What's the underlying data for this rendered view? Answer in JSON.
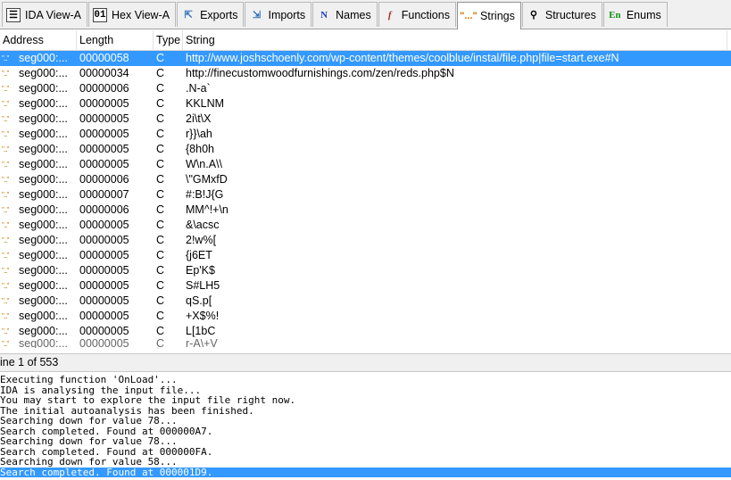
{
  "tabs": [
    {
      "label": "IDA View-A",
      "icon": "ida-view-icon",
      "active": false
    },
    {
      "label": "Hex View-A",
      "icon": "hex-view-icon",
      "active": false
    },
    {
      "label": "Exports",
      "icon": "exports-icon",
      "active": false
    },
    {
      "label": "Imports",
      "icon": "imports-icon",
      "active": false
    },
    {
      "label": "Names",
      "icon": "names-icon",
      "active": false
    },
    {
      "label": "Functions",
      "icon": "functions-icon",
      "active": false
    },
    {
      "label": "Strings",
      "icon": "strings-icon",
      "active": true
    },
    {
      "label": "Structures",
      "icon": "structures-icon",
      "active": false
    },
    {
      "label": "Enums",
      "icon": "enums-icon",
      "active": false
    }
  ],
  "tab_icons": {
    "ida": "☰",
    "hex": "01",
    "exports": "⇱",
    "imports": "⇲",
    "names": "N",
    "functions": "f",
    "strings": "\"...\"",
    "structures": "⚲",
    "enums": "En"
  },
  "columns": [
    "Address",
    "Length",
    "Type",
    "String"
  ],
  "row_icon": "\"...\"",
  "rows": [
    {
      "address": "seg000:...",
      "length": "00000058",
      "type": "C",
      "string": "http://www.joshschoenly.com/wp-content/themes/coolblue/instal/file.php|file=start.exe#N",
      "selected": true
    },
    {
      "address": "seg000:...",
      "length": "00000034",
      "type": "C",
      "string": "http://finecustomwoodfurnishings.com/zen/reds.php$N"
    },
    {
      "address": "seg000:...",
      "length": "00000006",
      "type": "C",
      "string": ".N-a`"
    },
    {
      "address": "seg000:...",
      "length": "00000005",
      "type": "C",
      "string": "KKLNM"
    },
    {
      "address": "seg000:...",
      "length": "00000005",
      "type": "C",
      "string": "2i\\t\\X"
    },
    {
      "address": "seg000:...",
      "length": "00000005",
      "type": "C",
      "string": "r}}\\ah"
    },
    {
      "address": "seg000:...",
      "length": "00000005",
      "type": "C",
      "string": "{8h0h"
    },
    {
      "address": "seg000:...",
      "length": "00000005",
      "type": "C",
      "string": "W\\n.A\\\\"
    },
    {
      "address": "seg000:...",
      "length": "00000006",
      "type": "C",
      "string": "\\\"GMxfD"
    },
    {
      "address": "seg000:...",
      "length": "00000007",
      "type": "C",
      "string": "#:B!J{G"
    },
    {
      "address": "seg000:...",
      "length": "00000006",
      "type": "C",
      "string": "MM^!+\\n"
    },
    {
      "address": "seg000:...",
      "length": "00000005",
      "type": "C",
      "string": "&\\acsc"
    },
    {
      "address": "seg000:...",
      "length": "00000005",
      "type": "C",
      "string": "2!w%["
    },
    {
      "address": "seg000:...",
      "length": "00000005",
      "type": "C",
      "string": "{j6ET"
    },
    {
      "address": "seg000:...",
      "length": "00000005",
      "type": "C",
      "string": "Ep'K$"
    },
    {
      "address": "seg000:...",
      "length": "00000005",
      "type": "C",
      "string": "S#LH5"
    },
    {
      "address": "seg000:...",
      "length": "00000005",
      "type": "C",
      "string": "qS.p["
    },
    {
      "address": "seg000:...",
      "length": "00000005",
      "type": "C",
      "string": "+X$%!"
    },
    {
      "address": "seg000:...",
      "length": "00000005",
      "type": "C",
      "string": "L[1bC"
    }
  ],
  "partial_row": {
    "address": "seg000:...",
    "length": "00000005",
    "type": "C",
    "string": "r-A\\+V"
  },
  "status": "ine 1 of 553",
  "output_lines": [
    {
      "text": "Executing function 'OnLoad'...",
      "selected": false
    },
    {
      "text": "IDA is analysing the input file...",
      "selected": false
    },
    {
      "text": "You may start to explore the input file right now.",
      "selected": false
    },
    {
      "text": "The initial autoanalysis has been finished.",
      "selected": false
    },
    {
      "text": "Searching down for value 78...",
      "selected": false
    },
    {
      "text": "Search completed. Found at 000000A7.",
      "selected": false
    },
    {
      "text": "Searching down for value 78...",
      "selected": false
    },
    {
      "text": "Search completed. Found at 000000FA.",
      "selected": false
    },
    {
      "text": "Searching down for value 58...",
      "selected": false
    },
    {
      "text": "Search completed. Found at 000001D9.",
      "selected": true
    }
  ],
  "colors": {
    "selection": "#3399ff",
    "tabbar": "#f0f0f0"
  }
}
